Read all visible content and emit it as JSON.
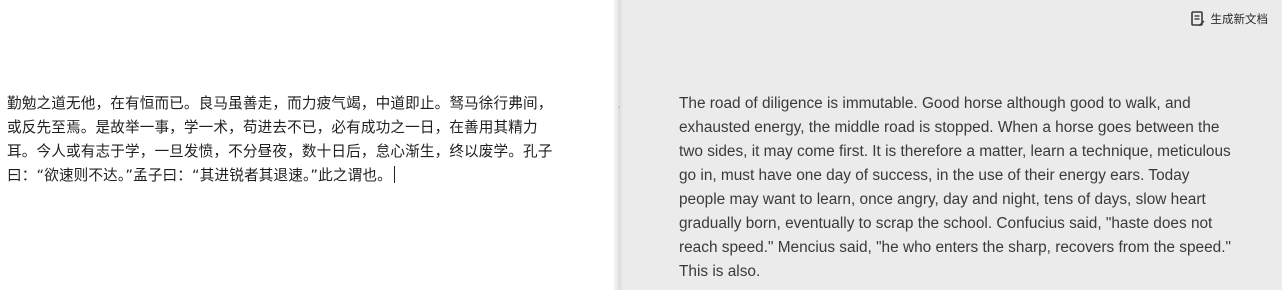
{
  "source": {
    "text": "勤勉之道无他，在有恒而已。良马虽善走，而力疲气竭，中道即止。驽马徐行弗间，或反先至焉。是故举一事，学一术，苟进去不已，必有成功之一日，在善用其精力耳。今人或有志于学，一旦发愤，不分昼夜，数十日后，怠心渐生，终以废学。孔子曰：“欲速则不达。”孟子曰：“其进锐者其退速。”此之谓也。"
  },
  "toolbar": {
    "generate_label": "生成新文档",
    "generate_icon": "document-edit-icon"
  },
  "translation": {
    "text": "The road of diligence is immutable. Good horse although good to walk, and exhausted energy, the middle road is stopped. When a horse goes between the two sides, it may come first. It is therefore a matter, learn a technique, meticulous go in, must have one day of success, in the use of their energy ears. Today people may want to learn, once angry, day and night, tens of days, slow heart gradually born, eventually to scrap the school. Confucius said, \"haste does not reach speed.\" Mencius said, \"he who enters the sharp, recovers from the speed.\" This is also."
  },
  "colors": {
    "left_background": "#ffffff",
    "right_background": "#ebebec",
    "text": "#3a3a3a"
  }
}
